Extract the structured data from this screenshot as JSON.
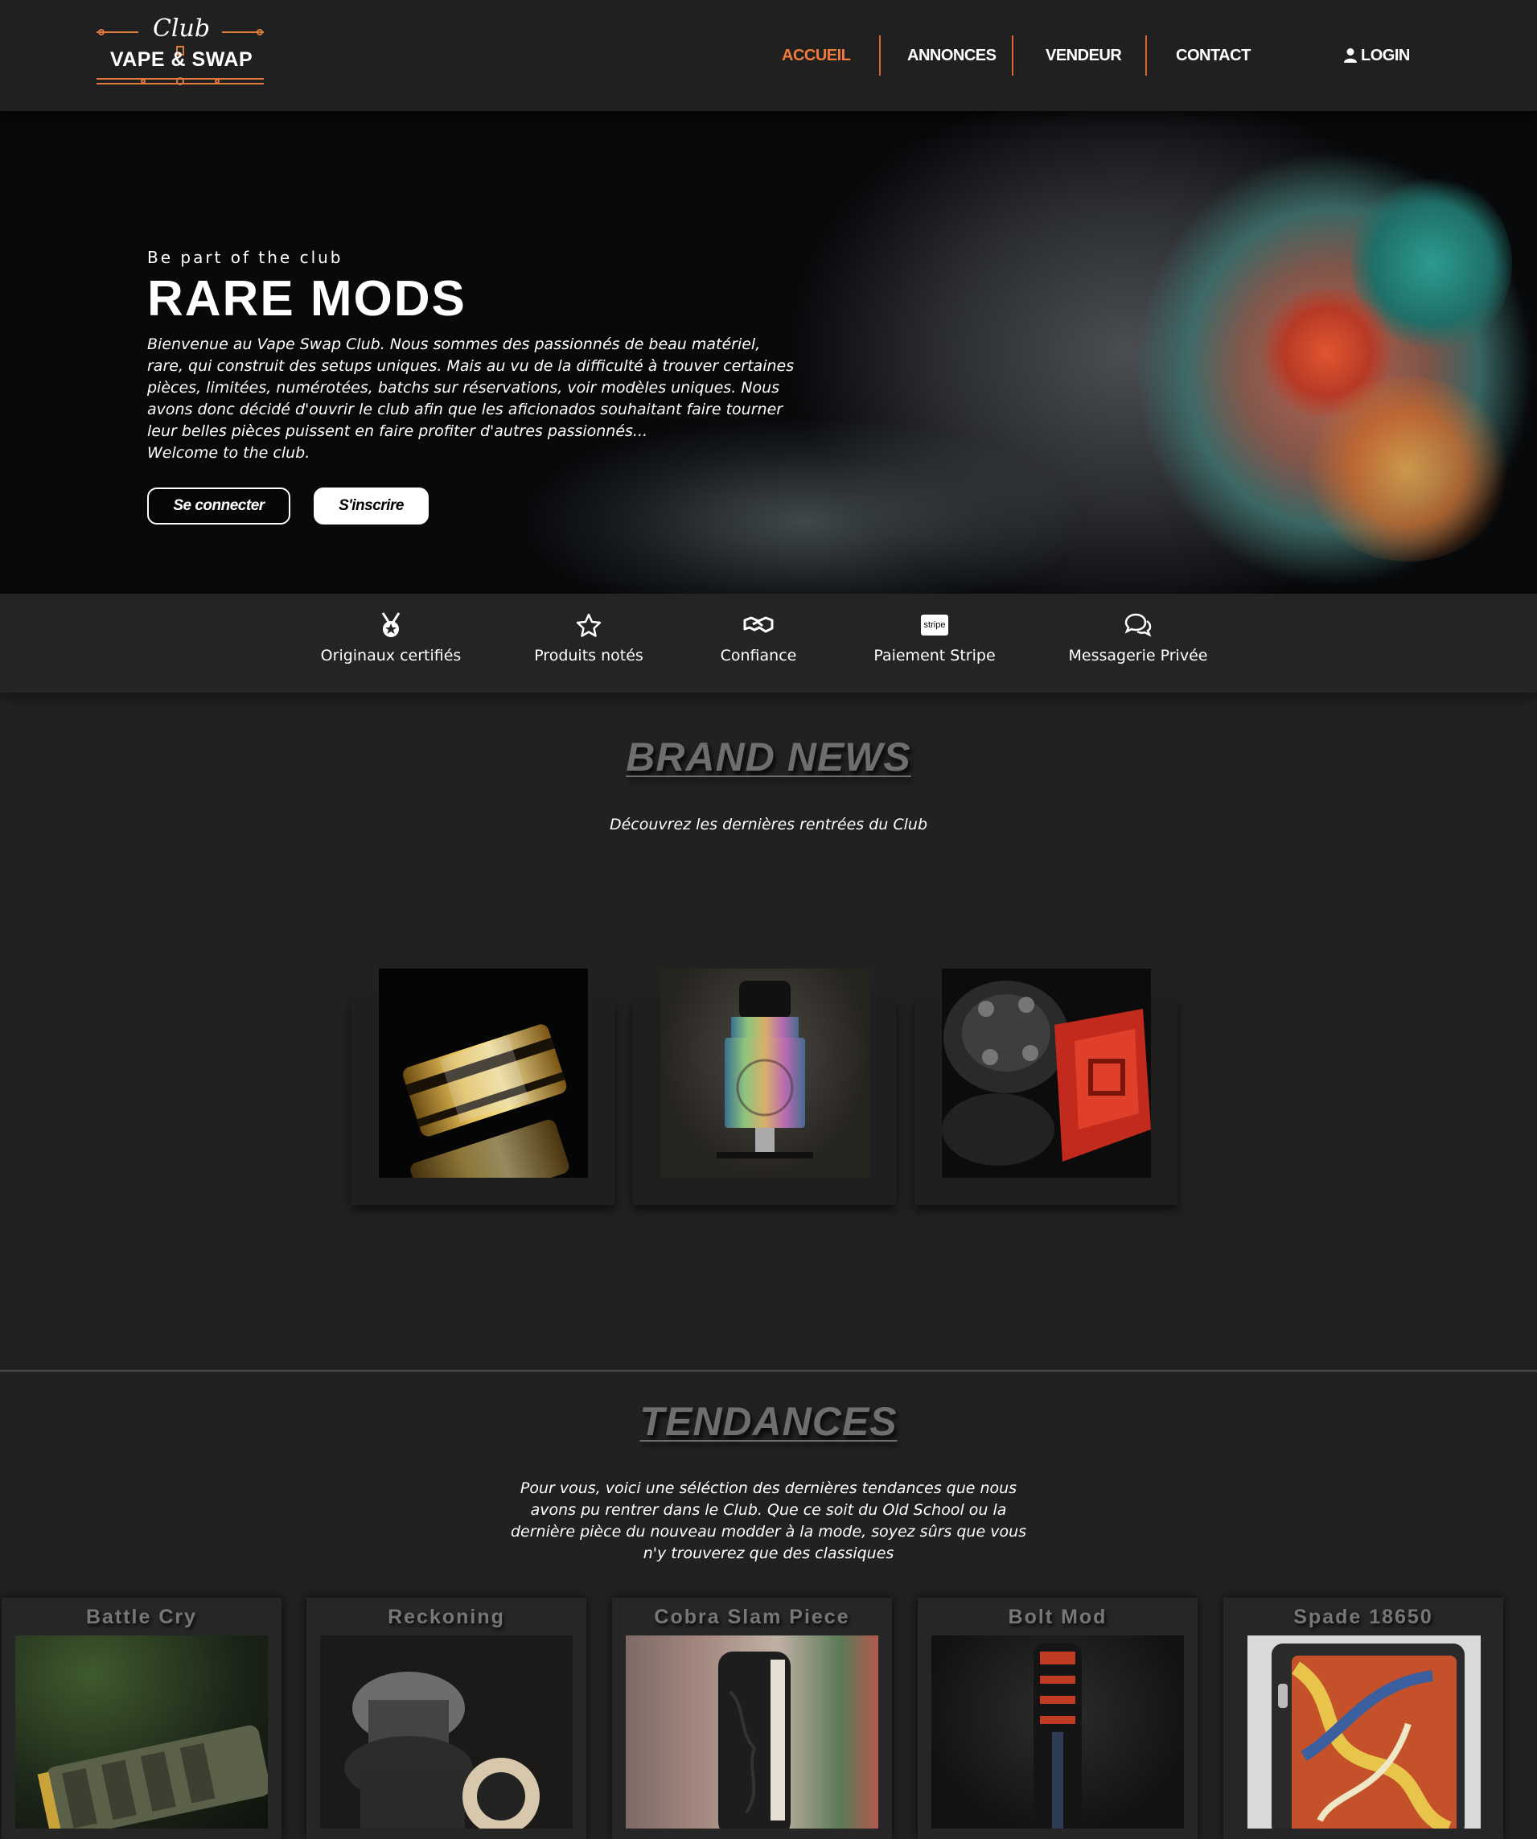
{
  "header": {
    "logo": {
      "club": "Club",
      "name": "VAPE & SWAP"
    },
    "nav": [
      {
        "label": "ACCUEIL",
        "active": true
      },
      {
        "label": "ANNONCES",
        "active": false
      },
      {
        "label": "VENDEUR",
        "active": false
      },
      {
        "label": "CONTACT",
        "active": false
      }
    ],
    "login": {
      "label": "LOGIN",
      "icon": "user-icon"
    }
  },
  "hero": {
    "kicker": "Be part of the club",
    "headline": "RARE MODS",
    "intro_lines": [
      "Bienvenue au Vape Swap Club. Nous sommes des passionnés de beau matériel,",
      "rare, qui construit des setups uniques. Mais au vu de la difficulté à trouver certaines",
      "pièces, limitées, numérotées, batchs sur réservations, voir modèles uniques. Nous",
      "avons donc décidé d'ouvrir le club afin que les aficionados souhaitant faire tourner",
      "leur belles pièces puissent en faire profiter d'autres passionnés...",
      "Welcome to the club."
    ],
    "buttons": {
      "login": "Se connecter",
      "signup": "S'inscrire"
    }
  },
  "features": [
    {
      "label": "Originaux certifiés",
      "icon": "medal-icon"
    },
    {
      "label": "Produits notés",
      "icon": "star-icon"
    },
    {
      "label": "Confiance",
      "icon": "handshake-icon"
    },
    {
      "label": "Paiement Stripe",
      "icon": "stripe-icon",
      "icon_text": "stripe"
    },
    {
      "label": "Messagerie Privée",
      "icon": "chat-icon"
    }
  ],
  "brand_news": {
    "title": "BRAND NEWS",
    "subtitle": "Découvrez les dernières rentrées du Club",
    "items": [
      {
        "image": "gold-rta-image"
      },
      {
        "image": "rainbow-rda-image"
      },
      {
        "image": "red-black-rda-image"
      }
    ]
  },
  "tendances": {
    "title": "TENDANCES",
    "subtitle_lines": [
      "Pour vous, voici une séléction des dernières tendances que nous",
      "avons pu rentrer dans le Club. Que ce soit du Old School ou la",
      "dernière pièce du nouveau modder à la mode, soyez sûrs que vous",
      "n'y trouverez que des classiques"
    ],
    "items": [
      {
        "title": "Battle Cry"
      },
      {
        "title": "Reckoning"
      },
      {
        "title": "Cobra Slam Piece"
      },
      {
        "title": "Bolt Mod"
      },
      {
        "title": "Spade 18650"
      }
    ]
  },
  "colors": {
    "accent": "#f07a3a",
    "background": "#212121",
    "header": "#202020"
  }
}
